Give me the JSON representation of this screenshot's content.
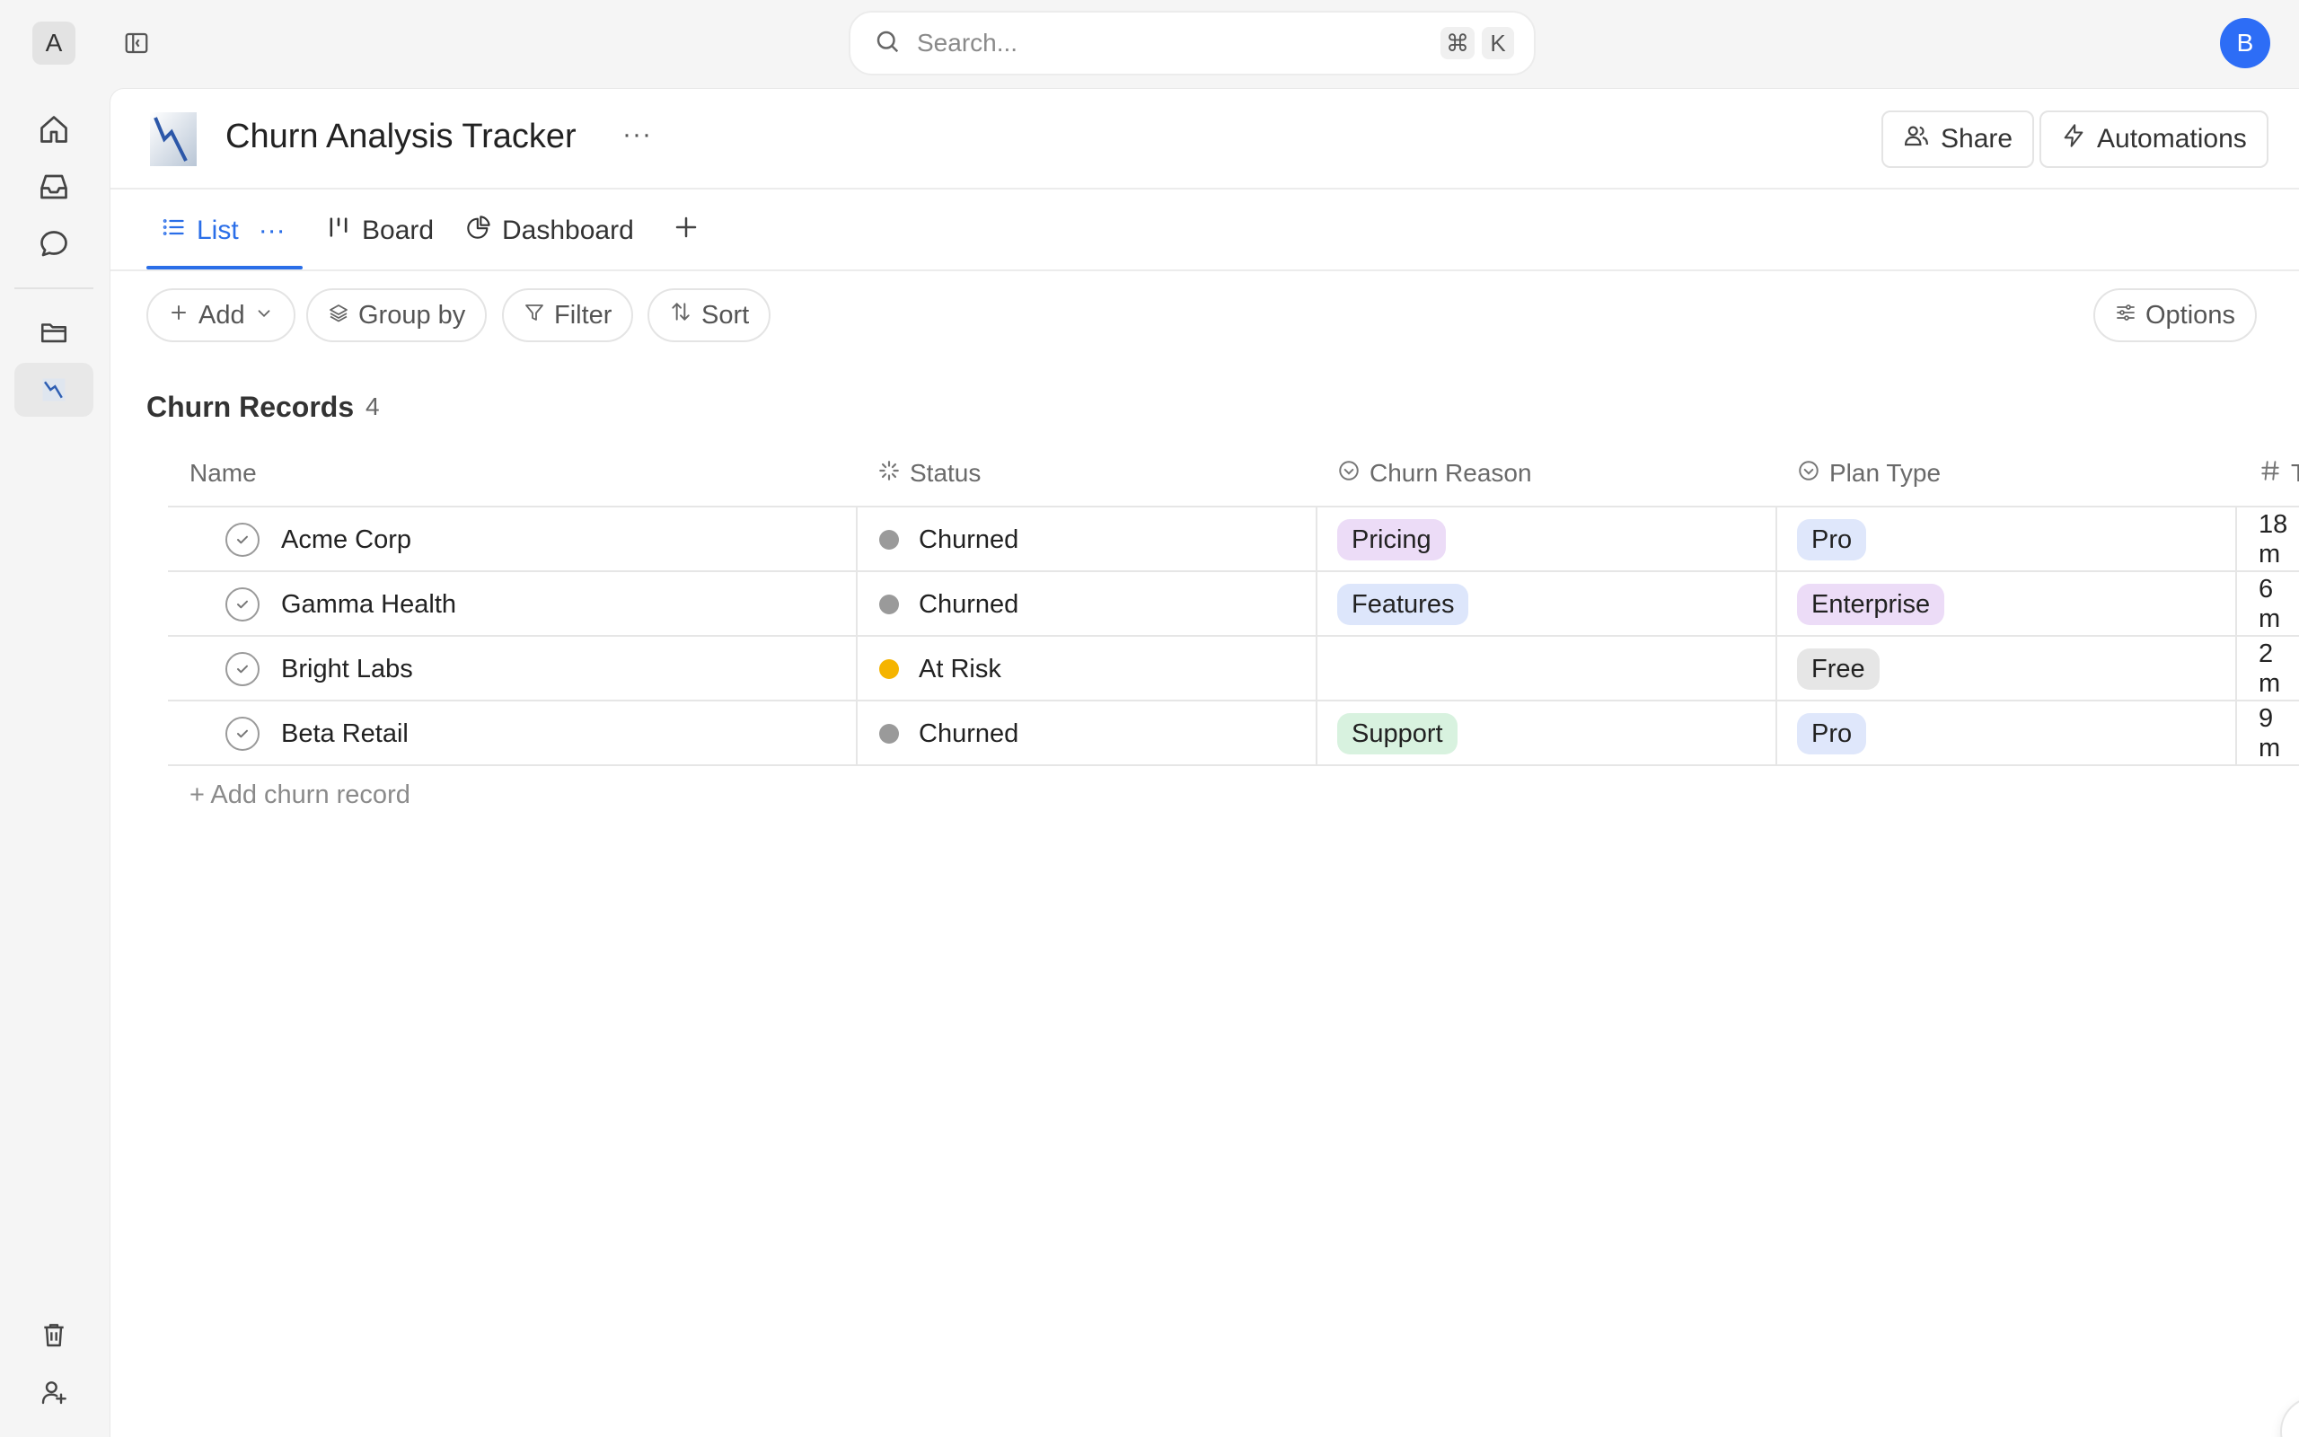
{
  "workspace": {
    "initial": "A"
  },
  "search": {
    "placeholder": "Search...",
    "shortcut_cmd": "⌘",
    "shortcut_key": "K"
  },
  "user": {
    "initial": "B"
  },
  "page": {
    "title": "Churn Analysis Tracker",
    "more": "···"
  },
  "header_buttons": {
    "share": "Share",
    "automations": "Automations"
  },
  "tabs": [
    {
      "label": "List",
      "active": true,
      "more": "···"
    },
    {
      "label": "Board"
    },
    {
      "label": "Dashboard"
    }
  ],
  "toolbar": {
    "add": "Add",
    "group_by": "Group by",
    "filter": "Filter",
    "sort": "Sort",
    "options": "Options"
  },
  "section": {
    "title": "Churn Records",
    "count": "4"
  },
  "table": {
    "columns": [
      {
        "label": "Name"
      },
      {
        "label": "Status"
      },
      {
        "label": "Churn Reason"
      },
      {
        "label": "Plan Type"
      },
      {
        "label": "T"
      }
    ],
    "rows": [
      {
        "name": "Acme Corp",
        "status": "Churned",
        "reason": "Pricing",
        "plan": "Pro",
        "tenure": "18 m"
      },
      {
        "name": "Gamma Health",
        "status": "Churned",
        "reason": "Features",
        "plan": "Enterprise",
        "tenure": "6 m"
      },
      {
        "name": "Bright Labs",
        "status": "At Risk",
        "reason": "",
        "plan": "Free",
        "tenure": "2 m"
      },
      {
        "name": "Beta Retail",
        "status": "Churned",
        "reason": "Support",
        "plan": "Pro",
        "tenure": "9 m"
      }
    ],
    "add_label": "+ Add churn record"
  },
  "colors": {
    "accent": "#2a6ee8",
    "status_churned": "#9a9a9a",
    "status_at_risk": "#f5b400",
    "tag_pricing": "#ecdcf7",
    "tag_features": "#dde6fb",
    "tag_support": "#d8f2df",
    "tag_pro": "#dfe7fb",
    "tag_enterprise": "#ecdcf7",
    "tag_free": "#e6e6e6"
  }
}
